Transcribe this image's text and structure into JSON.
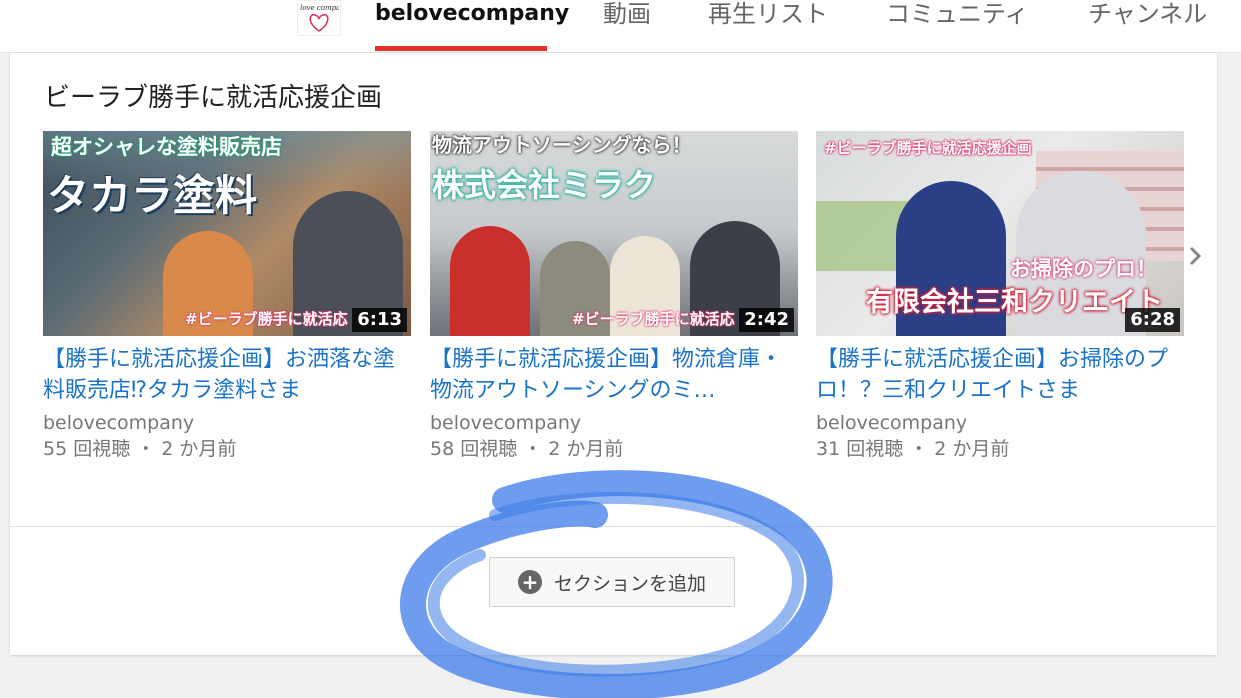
{
  "nav": {
    "channel_tab": "belovecompany",
    "tabs": [
      "動画",
      "再生リスト",
      "コミュニティ",
      "チャンネル"
    ],
    "avatar_text": "be love company"
  },
  "shelf": {
    "title": "ビーラブ勝手に就活応援企画",
    "videos": [
      {
        "thumb_top_caption": "超オシャレな塗料販売店",
        "thumb_main_caption": "タカラ塗料",
        "thumb_bottom_caption": "#ビーラブ勝手に就活応",
        "duration": "6:13",
        "title": "【勝手に就活応援企画】お洒落な塗料販売店⁉タカラ塗料さま",
        "channel": "belovecompany",
        "meta": "55 回視聴 ・ 2 か月前"
      },
      {
        "thumb_top_caption": "物流アウトソーシングなら！",
        "thumb_main_caption": "株式会社ミラク",
        "thumb_bottom_caption": "#ビーラブ勝手に就活応",
        "duration": "2:42",
        "title": "【勝手に就活応援企画】物流倉庫・物流アウトソーシングのミ…",
        "channel": "belovecompany",
        "meta": "58 回視聴 ・ 2 か月前"
      },
      {
        "thumb_top_caption": "#ビーラブ勝手に就活応援企画",
        "thumb_main_caption": "有限会社三和クリエイト",
        "thumb_sub_caption": "お掃除のプロ！",
        "duration": "6:28",
        "title": "【勝手に就活応援企画】お掃除のプロ！？三和クリエイトさま",
        "channel": "belovecompany",
        "meta": "31 回視聴 ・ 2 か月前"
      }
    ]
  },
  "add_section_label": "セクションを追加",
  "colors": {
    "accent_red": "#e5322d",
    "link_blue": "#1a73c7",
    "highlight_blue": "#3d7be8"
  }
}
